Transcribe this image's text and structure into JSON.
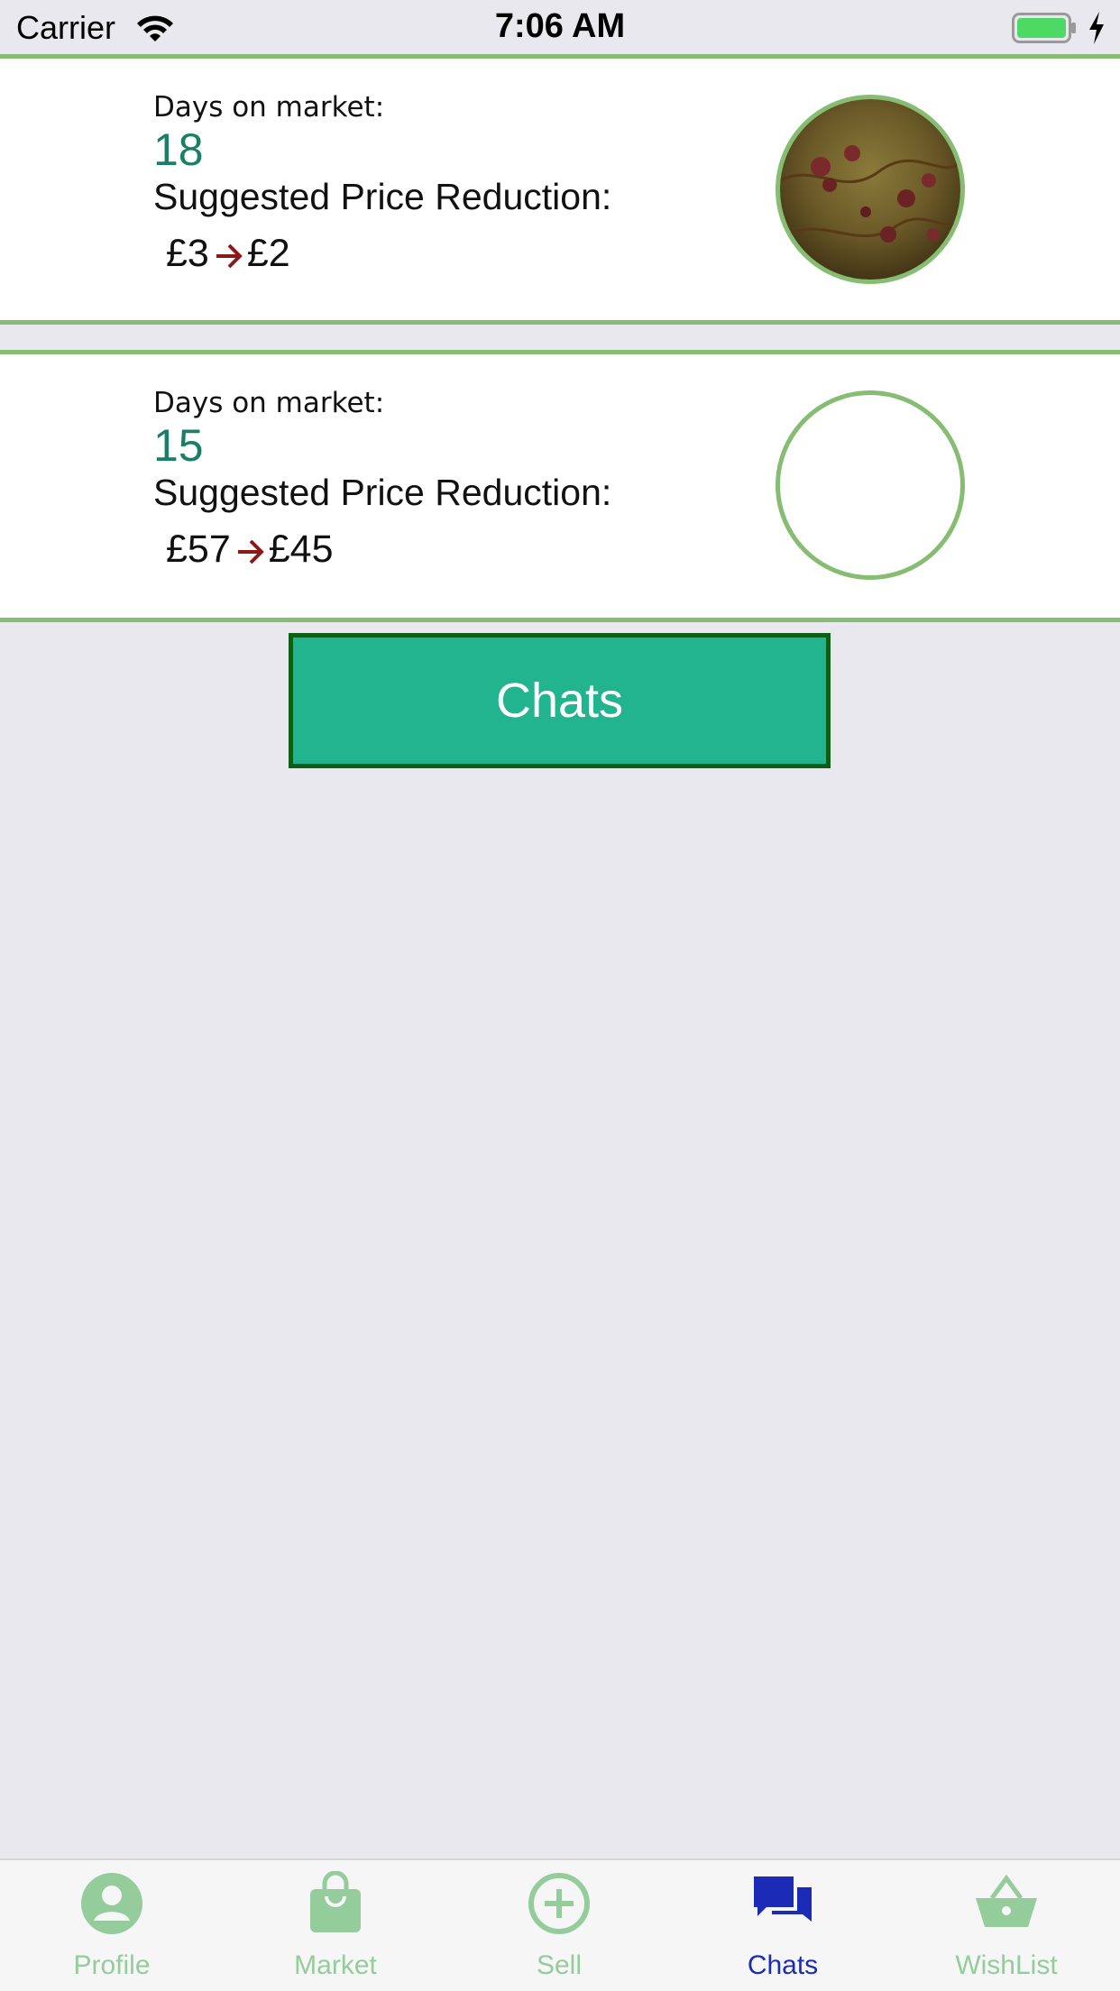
{
  "status_bar": {
    "carrier": "Carrier",
    "time": "7:06 AM",
    "wifi_icon": "wifi-icon",
    "battery_icon": "battery-icon",
    "charging_icon": "bolt-icon",
    "battery_color": "#4cd964"
  },
  "listings": [
    {
      "days_label": "Days on market:",
      "days_value": "18",
      "reduction_label": "Suggested Price Reduction:",
      "old_price": "£3",
      "new_price": "£2",
      "has_photo": true
    },
    {
      "days_label": "Days on market:",
      "days_value": "15",
      "reduction_label": "Suggested Price Reduction:",
      "old_price": "£57",
      "new_price": "£45",
      "has_photo": false
    }
  ],
  "chats_button": {
    "label": "Chats"
  },
  "tab_bar": {
    "tabs": [
      {
        "label": "Profile",
        "icon": "person-icon",
        "active": false
      },
      {
        "label": "Market",
        "icon": "shopping-bag-icon",
        "active": false
      },
      {
        "label": "Sell",
        "icon": "plus-circle-icon",
        "active": false
      },
      {
        "label": "Chats",
        "icon": "chat-bubbles-icon",
        "active": true
      },
      {
        "label": "WishList",
        "icon": "basket-icon",
        "active": false
      }
    ]
  },
  "colors": {
    "accent_green": "#86bd72",
    "days_value": "#1a7f67",
    "arrow": "#8b1a1a",
    "button_fill": "#21b48e",
    "button_border": "#0e5f16",
    "tab_inactive": "#94cc9c",
    "tab_active": "#1c2bb5"
  }
}
